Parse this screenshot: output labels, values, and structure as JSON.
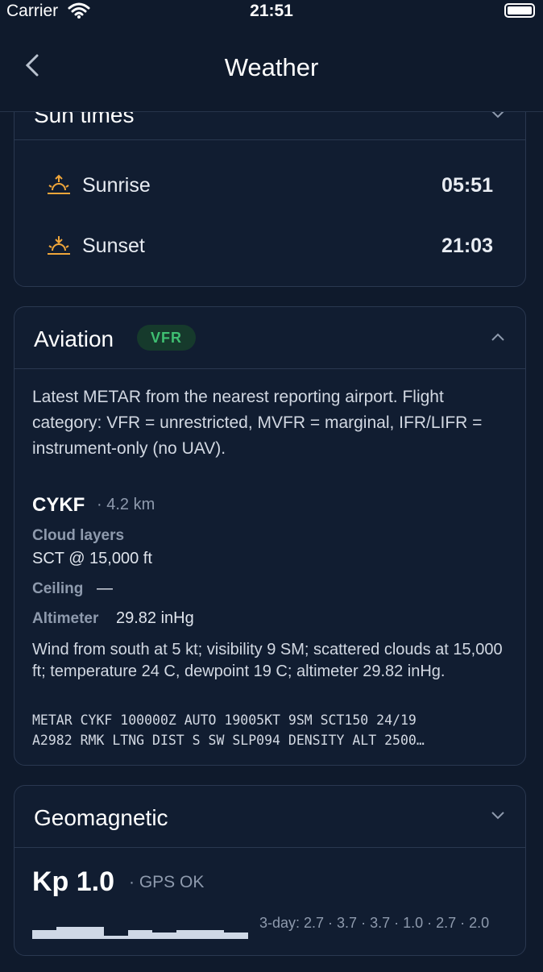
{
  "status_bar": {
    "carrier": "Carrier",
    "time": "21:51"
  },
  "nav": {
    "title": "Weather"
  },
  "sun_times": {
    "title": "Sun times",
    "rows": [
      {
        "label": "Sunrise",
        "value": "05:51",
        "icon": "sunrise-icon"
      },
      {
        "label": "Sunset",
        "value": "21:03",
        "icon": "sunset-icon"
      }
    ]
  },
  "aviation": {
    "title": "Aviation",
    "badge": "VFR",
    "description": "Latest METAR from the nearest reporting airport. Flight category: VFR = unrestricted, MVFR = marginal, IFR/LIFR = instrument-only (no UAV).",
    "station": "CYKF",
    "distance": "· 4.2 km",
    "cloud_layers_label": "Cloud layers",
    "cloud_layers_value": "SCT @ 15,000 ft",
    "ceiling_label": "Ceiling",
    "ceiling_value": "—",
    "altimeter_label": "Altimeter",
    "altimeter_value": "29.82 inHg",
    "decoded": "Wind from south at 5 kt; visibility 9 SM; scattered clouds at 15,000 ft; temperature 24 C, dewpoint 19 C; altimeter 29.82 inHg.",
    "raw_line1": "METAR CYKF 100000Z AUTO 19005KT 9SM SCT150 24/19",
    "raw_line2": "A2982 RMK LTNG DIST S SW SLP094 DENSITY ALT 2500…"
  },
  "geomagnetic": {
    "title": "Geomagnetic",
    "kp": "Kp 1.0",
    "status": "· GPS OK",
    "forecast": "3-day: 2.7 · 3.7 · 3.7 · 1.0 · 2.7 · 2.0",
    "bar_values": [
      2.7,
      3.7,
      3.7,
      1.0,
      2.7,
      2.0,
      2.7,
      2.7,
      2.0
    ]
  },
  "colors": {
    "accent_vfr": "#3fbf72",
    "sun_icon": "#f0a63a",
    "background": "#0f1a2c"
  }
}
